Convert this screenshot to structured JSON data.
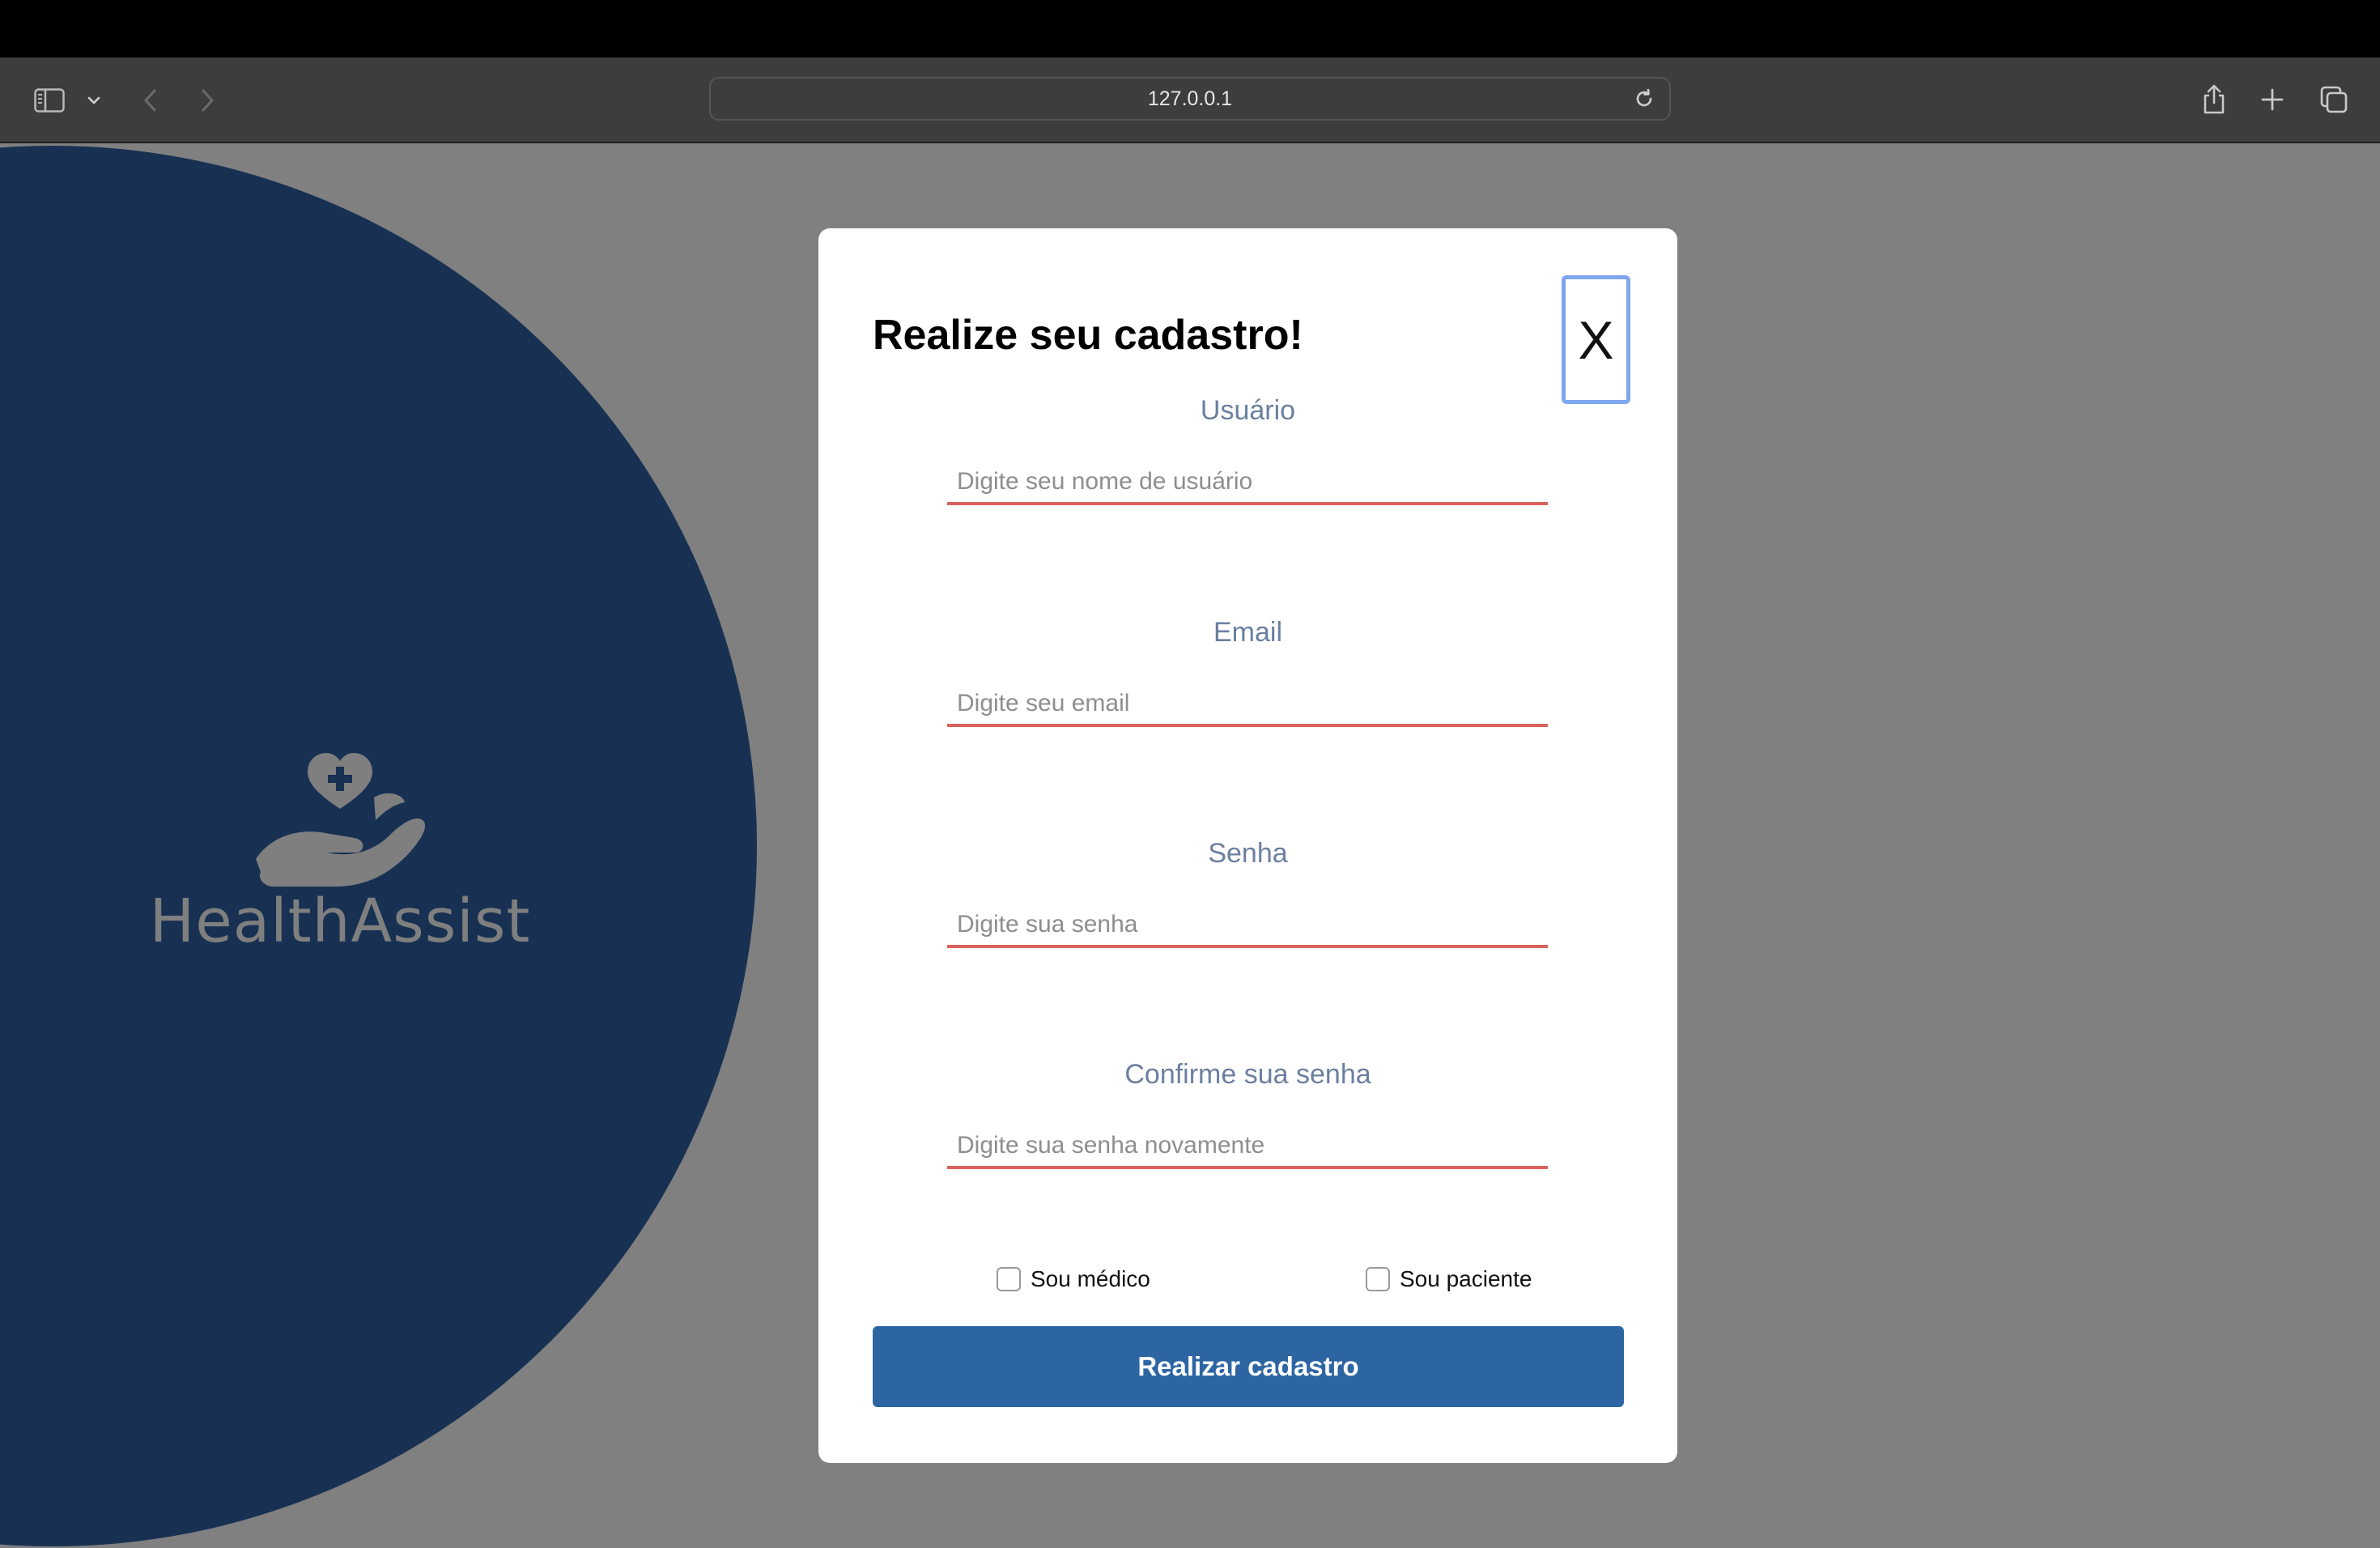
{
  "browser": {
    "url": "127.0.0.1"
  },
  "brand": {
    "name": "HealthAssist"
  },
  "modal": {
    "title": "Realize seu cadastro!",
    "close_label": "X",
    "fields": [
      {
        "label": "Usuário",
        "placeholder": "Digite seu nome de usuário",
        "value": ""
      },
      {
        "label": "Email",
        "placeholder": "Digite seu email",
        "value": ""
      },
      {
        "label": "Senha",
        "placeholder": "Digite sua senha",
        "value": ""
      },
      {
        "label": "Confirme sua senha",
        "placeholder": "Digite sua senha novamente",
        "value": ""
      }
    ],
    "checkboxes": [
      {
        "label": "Sou médico",
        "checked": false
      },
      {
        "label": "Sou paciente",
        "checked": false
      }
    ],
    "submit_label": "Realizar cadastro"
  },
  "colors": {
    "hero_circle": "#183153",
    "page_background": "#808080",
    "submit_button": "#2d65a3",
    "input_underline": "#d9635c",
    "field_label": "#6b7fa0",
    "close_button_border": "#7fa7ef",
    "logo": "#7f7f7f"
  },
  "icons": {
    "toolbar": [
      "sidebar-icon",
      "chevron-down-icon",
      "back-arrow-icon",
      "forward-arrow-icon",
      "reload-icon",
      "share-icon",
      "plus-icon",
      "tabs-overview-icon"
    ],
    "brand": "heart-hand-icon"
  }
}
